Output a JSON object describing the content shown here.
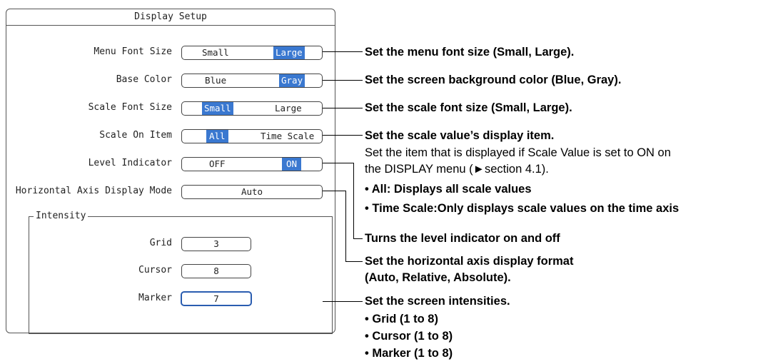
{
  "dialog": {
    "title": "Display Setup",
    "rows": [
      {
        "label": "Menu Font Size",
        "options": [
          "Small",
          "Large"
        ],
        "selected": 1
      },
      {
        "label": "Base Color",
        "options": [
          "Blue",
          "Gray"
        ],
        "selected": 1
      },
      {
        "label": "Scale Font Size",
        "options": [
          "Small",
          "Large"
        ],
        "selected": 0
      },
      {
        "label": "Scale On Item",
        "options": [
          "All",
          "Time Scale"
        ],
        "selected": 0
      },
      {
        "label": "Level Indicator",
        "options": [
          "OFF",
          "ON"
        ],
        "selected": 1
      },
      {
        "label": "Horizontal Axis Display Mode",
        "value": "Auto"
      }
    ],
    "intensity": {
      "title": "Intensity",
      "grid": {
        "label": "Grid",
        "value": "3"
      },
      "cursor": {
        "label": "Cursor",
        "value": "8"
      },
      "marker": {
        "label": "Marker",
        "value": "7"
      }
    },
    "selection_color": "#3a78d0"
  },
  "annotations": {
    "menu_font": "Set the menu font size (Small, Large).",
    "base_color": "Set the screen background color (Blue, Gray).",
    "scale_font": "Set the scale font size (Small, Large).",
    "scale_item": {
      "heading": "Set the scale value’s display item.",
      "line1": "Set the item that is displayed if Scale Value is set to ON on",
      "line2": "the DISPLAY menu (►section 4.1).",
      "bullet1": "• All: Displays all scale values",
      "bullet2": "• Time Scale:Only displays scale values on the time axis"
    },
    "level_indicator": "Turns the level indicator on and off",
    "horizontal_axis": {
      "line1": "Set the horizontal axis display format",
      "line2": "(Auto, Relative, Absolute)."
    },
    "intensities": {
      "heading": "Set the screen intensities.",
      "bullet1": "• Grid (1 to 8)",
      "bullet2": "• Cursor (1 to 8)",
      "bullet3": "• Marker (1 to 8)"
    }
  }
}
